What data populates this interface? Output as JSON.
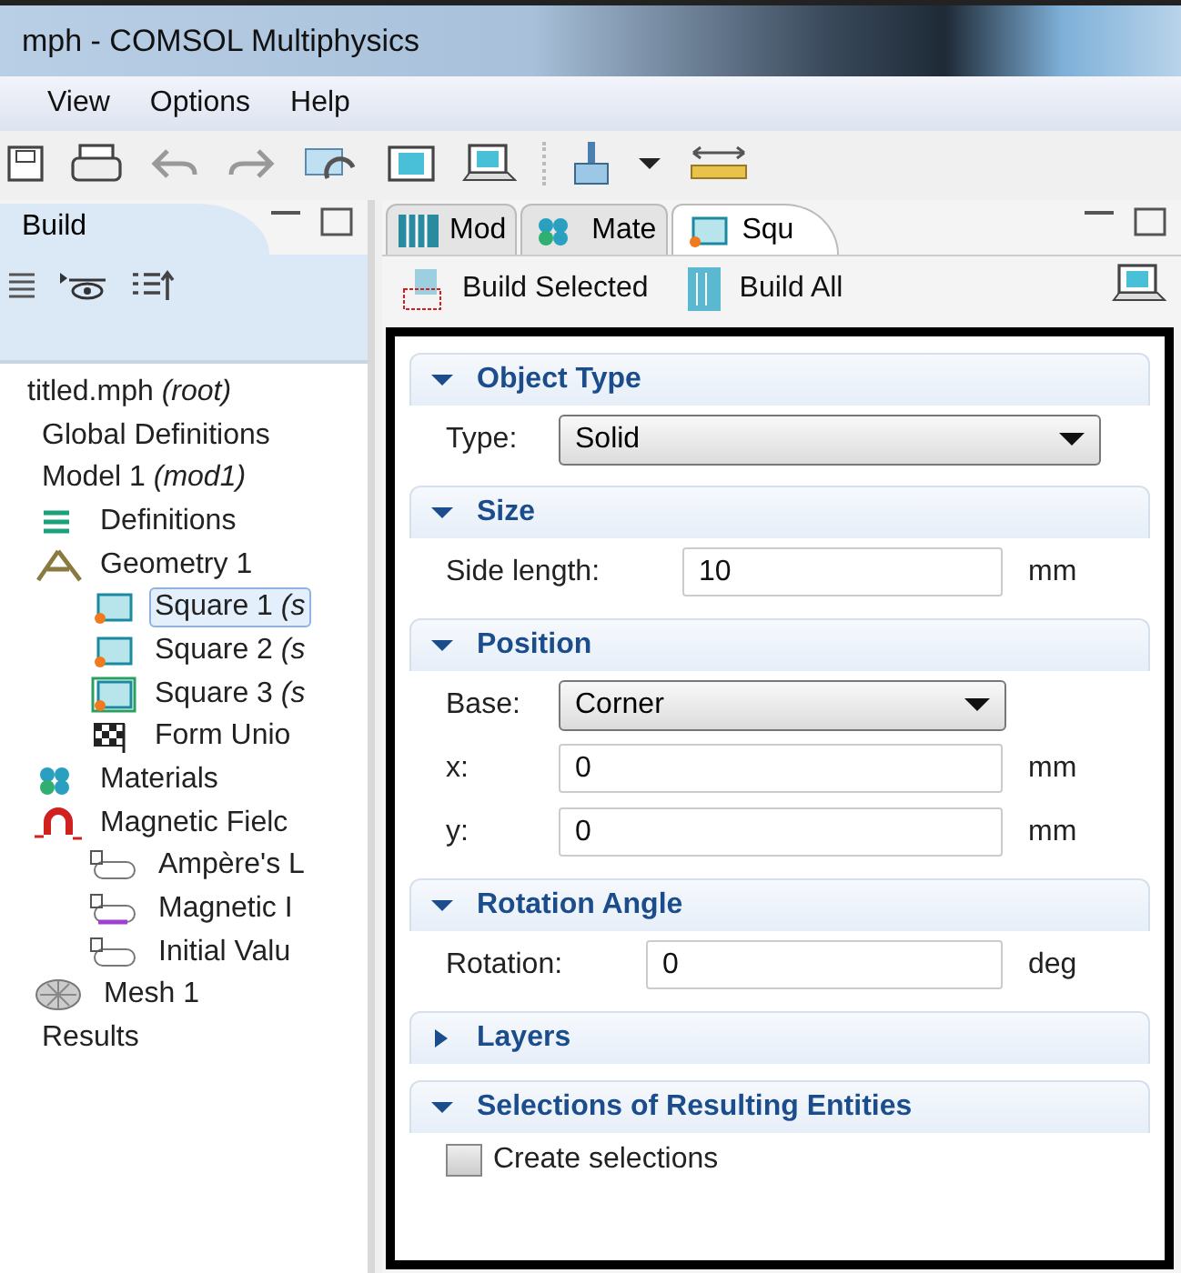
{
  "window": {
    "title": "mph - COMSOL Multiphysics"
  },
  "menu": [
    "View",
    "Options",
    "Help"
  ],
  "toolbar": [
    {
      "kind": "save"
    },
    {
      "kind": "print"
    },
    {
      "kind": "undo"
    },
    {
      "kind": "redo"
    },
    {
      "kind": "refresh"
    },
    {
      "kind": "help"
    },
    {
      "kind": "help-laptop"
    },
    {
      "kind": "separator"
    },
    {
      "kind": "brush"
    },
    {
      "kind": "caret"
    },
    {
      "kind": "ruler"
    }
  ],
  "builder": {
    "tab": "Build",
    "tools": [
      {
        "kind": "list"
      },
      {
        "kind": "eye"
      },
      {
        "kind": "list-up"
      }
    ],
    "tree": [
      {
        "label": "titled.mph *(root)*",
        "selected": false,
        "children": [
          {
            "label": "Global Definitions",
            "selected": false
          },
          {
            "label": "Model 1 *(mod1)*",
            "selected": false,
            "children": [
              {
                "label": "Definitions",
                "kind": "definitions",
                "selected": false
              },
              {
                "label": "Geometry 1",
                "kind": "geometry",
                "selected": false,
                "children": [
                  {
                    "label": "Square 1 *(s*",
                    "kind": "square",
                    "selected": true
                  },
                  {
                    "label": "Square 2 *(s*",
                    "kind": "square",
                    "selected": false
                  },
                  {
                    "label": "Square 3 *(s*",
                    "kind": "square-framed",
                    "selected": false
                  },
                  {
                    "label": "Form Unio",
                    "kind": "flag",
                    "selected": false
                  }
                ]
              },
              {
                "label": "Materials",
                "kind": "materials",
                "selected": false
              },
              {
                "label": "Magnetic Fielc",
                "kind": "magnet",
                "selected": false,
                "children": [
                  {
                    "label": "Ampère's L",
                    "kind": "boundary",
                    "selected": false
                  },
                  {
                    "label": "Magnetic I",
                    "kind": "boundary-purple",
                    "selected": false
                  },
                  {
                    "label": "Initial Valu",
                    "kind": "boundary",
                    "selected": false
                  }
                ]
              },
              {
                "label": "Mesh 1",
                "kind": "mesh",
                "selected": false
              }
            ]
          },
          {
            "label": "Results",
            "selected": false
          }
        ]
      }
    ]
  },
  "settings": {
    "tabs": [
      {
        "label": "Mod",
        "kind": "model",
        "selected": false
      },
      {
        "label": "Mate",
        "kind": "materials",
        "selected": false
      },
      {
        "label": "Squ",
        "kind": "square",
        "selected": true
      }
    ],
    "actions": [
      {
        "label": "Build Selected",
        "kind": "build-selected"
      },
      {
        "label": "Build All",
        "kind": "build-all"
      }
    ],
    "sections": [
      {
        "title": "Object Type",
        "expanded": true,
        "fields": [
          {
            "kind": "select",
            "label": "Type:",
            "value": "Solid"
          }
        ]
      },
      {
        "title": "Size",
        "expanded": true,
        "fields": [
          {
            "kind": "input",
            "label": "Side length:",
            "value": "10",
            "unit": "mm"
          }
        ]
      },
      {
        "title": "Position",
        "expanded": true,
        "fields": [
          {
            "kind": "select",
            "label": "Base:",
            "value": "Corner"
          },
          {
            "kind": "input",
            "label": "x:",
            "value": "0",
            "unit": "mm"
          },
          {
            "kind": "input",
            "label": "y:",
            "value": "0",
            "unit": "mm"
          }
        ]
      },
      {
        "title": "Rotation Angle",
        "expanded": true,
        "fields": [
          {
            "kind": "input",
            "label": "Rotation:",
            "value": "0",
            "unit": "deg"
          }
        ]
      },
      {
        "title": "Layers",
        "expanded": false
      },
      {
        "title": "Selections of Resulting Entities",
        "expanded": true,
        "fields": [
          {
            "kind": "checkbox",
            "label": "Create selections",
            "checked": false
          }
        ]
      }
    ]
  }
}
